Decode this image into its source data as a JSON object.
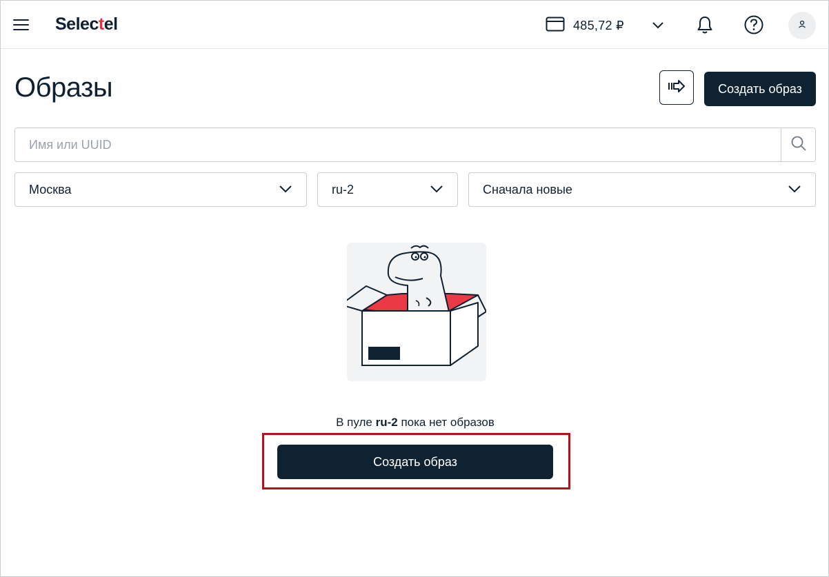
{
  "header": {
    "logo": {
      "part1": "Se",
      "part2": "l",
      "part3": "ec",
      "part4": "t",
      "part5": "el"
    },
    "balance": "485,72 ₽",
    "icons": [
      "menu-icon",
      "card-icon",
      "chevron-down-icon",
      "bell-icon",
      "help-icon",
      "user-icon"
    ]
  },
  "page": {
    "title": "Образы",
    "create_button": "Создать образ"
  },
  "search": {
    "placeholder": "Имя или UUID",
    "value": ""
  },
  "filters": {
    "region": "Москва",
    "pool": "ru-2",
    "sort": "Сначала новые"
  },
  "empty_state": {
    "prefix": "В пуле ",
    "pool": "ru-2",
    "suffix": " пока нет образов",
    "button": "Создать образ"
  },
  "colors": {
    "brand_dark": "#0e2231",
    "brand_red": "#e8323c",
    "highlight": "#b3121b"
  }
}
